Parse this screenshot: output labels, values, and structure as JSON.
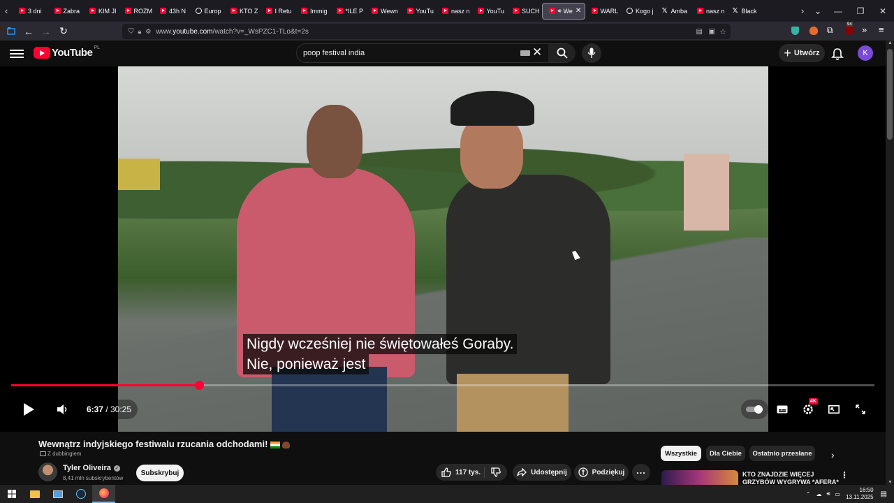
{
  "browser": {
    "tabs": [
      {
        "label": "3 dni",
        "icon": "youtube-icon"
      },
      {
        "label": "Zabra",
        "icon": "youtube-icon"
      },
      {
        "label": "KIM JI",
        "icon": "youtube-icon"
      },
      {
        "label": "ROZM",
        "icon": "youtube-icon"
      },
      {
        "label": "43h N",
        "icon": "youtube-icon"
      },
      {
        "label": "Europ",
        "icon": "circle-icon"
      },
      {
        "label": "KTO Z",
        "icon": "youtube-icon"
      },
      {
        "label": "I Retu",
        "icon": "youtube-icon"
      },
      {
        "label": "Immig",
        "icon": "youtube-icon"
      },
      {
        "label": "*ILE P",
        "icon": "youtube-icon"
      },
      {
        "label": "Wewn",
        "icon": "youtube-icon"
      },
      {
        "label": "YouTu",
        "icon": "youtube-icon"
      },
      {
        "label": "nasz n",
        "icon": "youtube-icon"
      },
      {
        "label": "YouTu",
        "icon": "youtube-icon"
      },
      {
        "label": "SUCH",
        "icon": "youtube-icon"
      },
      {
        "label": "We",
        "icon": "youtube-icon",
        "active": true
      },
      {
        "label": "WARL",
        "icon": "youtube-icon"
      },
      {
        "label": "Kogo j",
        "icon": "circle-icon"
      },
      {
        "label": "Amba",
        "icon": "x-icon"
      },
      {
        "label": "nasz n",
        "icon": "youtube-icon"
      },
      {
        "label": "Black",
        "icon": "x-icon"
      }
    ],
    "url_prefix": "www.",
    "url_domain": "youtube.com",
    "url_path": "/watch?v=_WsPZC1-TLo&t=2s",
    "extension_badge": "94"
  },
  "header": {
    "logo_text": "YouTube",
    "logo_region": "PL",
    "search_value": "poop festival india",
    "create_label": "Utwórz",
    "avatar_letter": "K"
  },
  "player": {
    "subtitle_line1": "Nigdy wcześniej nie świętowałeś Goraby.",
    "subtitle_line2": "Nie, ponieważ jest",
    "current_time": "6:37",
    "time_separator": " / ",
    "duration": "30:25",
    "quality_badge": "4K",
    "progress_fraction": 0.218
  },
  "video": {
    "title": "Wewnątrz indyjskiego festiwalu rzucania odchodami!",
    "dubbing_label": "Z dubbingiem",
    "channel_name": "Tyler Oliveira",
    "subscriber_count": "8,41 mln subskrybentów",
    "subscribe_label": "Subskrybuj",
    "like_count": "117 tys.",
    "share_label": "Udostępnij",
    "thanks_label": "Podziękuj"
  },
  "sidebar": {
    "chips": [
      "Wszystkie",
      "Dla Ciebie",
      "Ostatnio przesłane"
    ],
    "rec_title_line1": "KTO ZNAJDZIE WIĘCEJ",
    "rec_title_line2": "GRZYBÓW WYGRYWA *AFERA*"
  },
  "taskbar": {
    "time": "16:50",
    "date": "13.11.2025"
  },
  "colors": {
    "accent_red": "#ff0033",
    "background": "#0f0f0f",
    "avatar": "#7a4bd6"
  }
}
